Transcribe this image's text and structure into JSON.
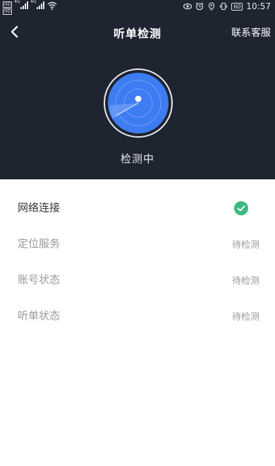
{
  "statusbar": {
    "hd_top": "HD",
    "hd_bottom": "HD",
    "net1": "4G",
    "net2": "4G",
    "battery": "60",
    "time": "10:57"
  },
  "nav": {
    "back_icon": "chevron-left-icon",
    "title": "听单检测",
    "service_label": "联系客服"
  },
  "detect": {
    "status_text": "检测中"
  },
  "checks": [
    {
      "label": "网络连接",
      "status": "",
      "done": true,
      "icon": "check-circle-icon"
    },
    {
      "label": "定位服务",
      "status": "待检测",
      "done": false
    },
    {
      "label": "账号状态",
      "status": "待检测",
      "done": false
    },
    {
      "label": "听单状态",
      "status": "待检测",
      "done": false
    }
  ],
  "colors": {
    "header_bg": "#1f2431",
    "radar_blue": "#3d7cf2",
    "check_green": "#3bb97e",
    "pending_text": "#999999"
  }
}
